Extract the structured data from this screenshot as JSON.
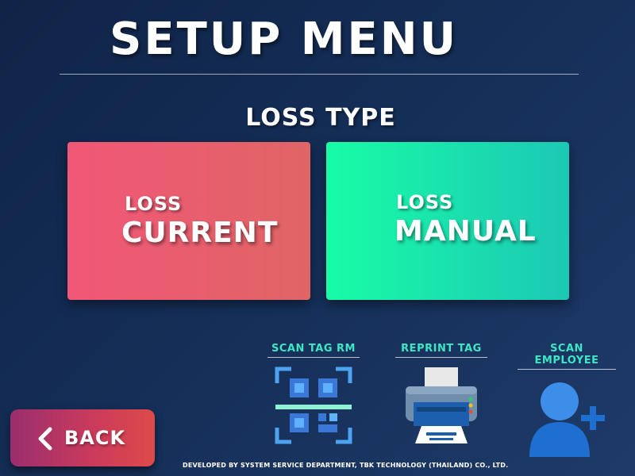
{
  "header": {
    "title": "SETUP MENU"
  },
  "section": {
    "title": "LOSS TYPE"
  },
  "cards": {
    "current": {
      "line1": "LOSS",
      "line2": "CURRENT",
      "color_start": "#f15777",
      "color_end": "#e06565"
    },
    "manual": {
      "line1": "LOSS",
      "line2": "MANUAL",
      "color_start": "#18fca6",
      "color_end": "#1cc8b5"
    }
  },
  "tools": {
    "scan_tag_rm": {
      "label": "SCAN TAG RM",
      "icon": "qr-scan-icon"
    },
    "reprint_tag": {
      "label": "REPRINT TAG",
      "icon": "printer-icon"
    },
    "scan_employee": {
      "label": "SCAN EMPLOYEE",
      "icon": "add-user-icon"
    }
  },
  "back": {
    "label": "BACK",
    "icon": "chevron-left-icon"
  },
  "footer": {
    "text": "DEVELOPED BY SYSTEM SERVICE DEPARTMENT, TBK TECHNOLOGY (THAILAND) CO., LTD."
  },
  "colors": {
    "accent_label": "#3fe6c4",
    "background": "#16305a"
  }
}
